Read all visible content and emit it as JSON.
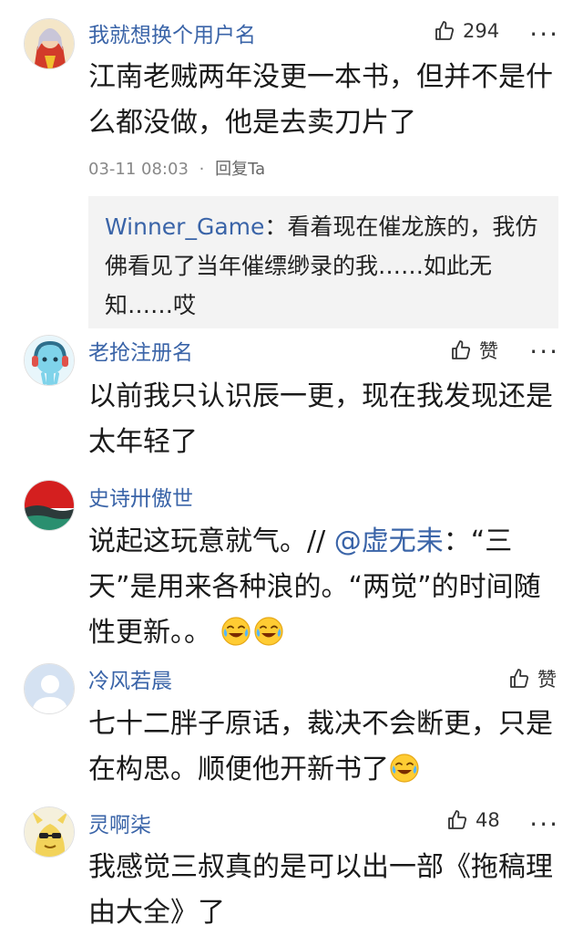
{
  "comments": [
    {
      "username": "我就想换个用户名",
      "likes": "294",
      "text": "江南老贼两年没更一本书，但并不是什么都没做，他是去卖刀片了",
      "time": "03-11 08:03",
      "dot": "·",
      "reply": "回复Ta",
      "quote_name": "Winner_Game",
      "quote_sep": "：",
      "quote_text": "看着现在催龙族的，我仿佛看见了当年催缥缈录的我……如此无知……哎"
    },
    {
      "username": "老抢注册名",
      "likes": "赞",
      "text": "以前我只认识辰一更，现在我发现还是太年轻了"
    },
    {
      "username": "史诗卅傲世",
      "text_before": "说起这玩意就气。// ",
      "mention": "@虚无耒",
      "text_after": "：“三天”是用来各种浪的。“两觉”的时间随性更新。。"
    },
    {
      "username": "冷风若晨",
      "likes": "赞",
      "text": "七十二胖子原话，裁决不会断更，只是在构思。顺便他开新书了"
    },
    {
      "username": "灵啊柒",
      "likes": "48",
      "text": "我感觉三叔真的是可以出一部《拖稿理由大全》了"
    }
  ],
  "icons": {
    "like": "thumbs-up-icon",
    "more": "more-icon",
    "emoji": "laughing-crying-emoji"
  },
  "more_label": "···",
  "colors": {
    "username": "#3a64a8",
    "quote_bg": "#f3f3f3"
  }
}
